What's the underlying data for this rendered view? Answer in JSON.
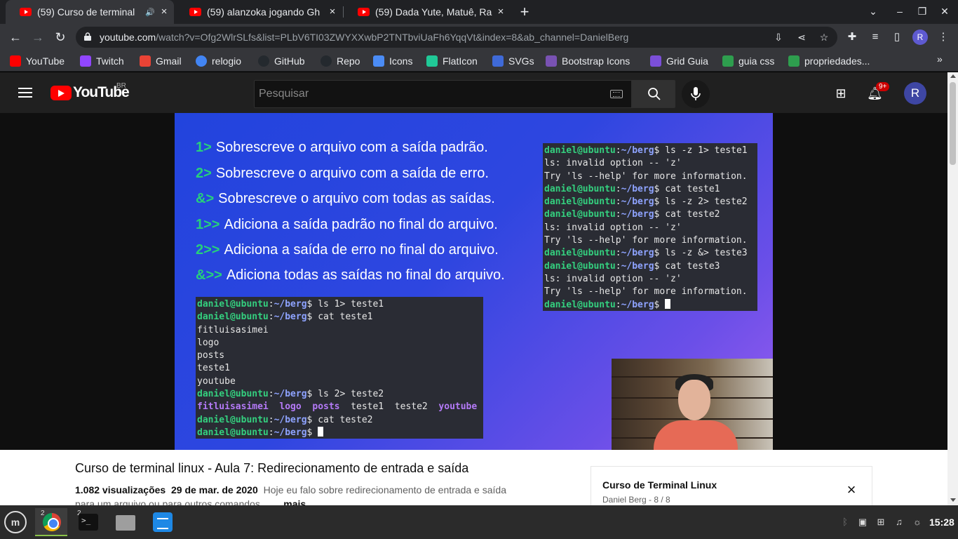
{
  "browser": {
    "tabs": [
      {
        "title": "(59) Curso de terminal",
        "active": true,
        "audio": true
      },
      {
        "title": "(59) alanzoka jogando Gh",
        "active": false
      },
      {
        "title": "(59) Dada Yute, Matuê, Ra",
        "active": false
      }
    ],
    "url_host": "youtube.com",
    "url_path": "/watch?v=Ofg2WlrSLfs&list=PLbV6TI03ZWYXXwbP2TNTbviUaFh6YqqVt&index=8&ab_channel=DanielBerg",
    "profile_initial": "R",
    "bookmarks": [
      {
        "label": "YouTube",
        "color": "#ff0000"
      },
      {
        "label": "Twitch",
        "color": "#9146ff"
      },
      {
        "label": "Gmail",
        "color": "#ea4335"
      },
      {
        "label": "relogio",
        "color": "#4285f4"
      },
      {
        "label": "GitHub",
        "color": "#24292e"
      },
      {
        "label": "Repo",
        "color": "#24292e"
      },
      {
        "label": "Icons",
        "color": "#4b8cf5"
      },
      {
        "label": "FlatIcon",
        "color": "#20c997"
      },
      {
        "label": "SVGs",
        "color": "#3f6ad8"
      },
      {
        "label": "Bootstrap Icons",
        "color": "#7952b3"
      },
      {
        "label": "Grid Guia",
        "color": "#7b4fd8"
      },
      {
        "label": "guia css",
        "color": "#2e9e4e"
      },
      {
        "label": "propriedades...",
        "color": "#2e9e4e"
      }
    ]
  },
  "youtube": {
    "logo_text": "YouTube",
    "country": "BR",
    "search_placeholder": "Pesquisar",
    "notification_count": "9+",
    "avatar_initial": "R"
  },
  "video": {
    "slide_lines": [
      {
        "op": "1>",
        "text": "Sobrescreve o arquivo com a saída padrão."
      },
      {
        "op": "2>",
        "text": "Sobrescreve o arquivo com a saída de erro."
      },
      {
        "op": "&>",
        "text": "Sobrescreve o arquivo com todas as saídas."
      },
      {
        "op": "1>>",
        "text": "Adiciona a saída padrão no final do arquivo."
      },
      {
        "op": "2>>",
        "text": "Adiciona a saída de erro no final do arquivo."
      },
      {
        "op": "&>>",
        "text": "Adiciona todas as saídas no final do arquivo."
      }
    ],
    "prompt_user": "daniel@ubuntu",
    "prompt_dir": "~/berg",
    "terminal_left": [
      {
        "cmd": "ls 1> teste1"
      },
      {
        "cmd": "cat teste1"
      },
      {
        "out": "fitluisasimei"
      },
      {
        "out": "logo"
      },
      {
        "out": "posts"
      },
      {
        "out": "teste1"
      },
      {
        "out": "youtube"
      },
      {
        "cmd": "ls 2> teste2"
      },
      {
        "dirs": [
          "fitluisasimei",
          "logo",
          "posts"
        ],
        "files": [
          "teste1",
          "teste2"
        ],
        "dirs2": [
          "youtube"
        ]
      },
      {
        "cmd": "cat teste2"
      },
      {
        "cmd": "",
        "cursor": true
      }
    ],
    "terminal_right": [
      {
        "cmd": "ls -z 1> teste1"
      },
      {
        "out": "ls: invalid option -- 'z'"
      },
      {
        "out": "Try 'ls --help' for more information."
      },
      {
        "cmd": "cat teste1"
      },
      {
        "cmd": "ls -z 2> teste2"
      },
      {
        "cmd": "cat teste2"
      },
      {
        "out": "ls: invalid option -- 'z'"
      },
      {
        "out": "Try 'ls --help' for more information."
      },
      {
        "cmd": "ls -z &> teste3"
      },
      {
        "cmd": "cat teste3"
      },
      {
        "out": "ls: invalid option -- 'z'"
      },
      {
        "out": "Try 'ls --help' for more information."
      },
      {
        "cmd": "",
        "cursor": true
      }
    ]
  },
  "video_info": {
    "title": "Curso de terminal linux - Aula 7: Redirecionamento de entrada e saída",
    "views": "1.082 visualizações",
    "date": "29 de mar. de 2020",
    "description_line1": "Hoje eu falo sobre redirecionamento de entrada e saída",
    "description_line2": "para um arquivo ou para outros comandos.",
    "more": "...mais"
  },
  "playlist": {
    "title": "Curso de Terminal Linux",
    "subtitle": "Daniel Berg - 8 / 8"
  },
  "taskbar": {
    "chrome_badge": "2",
    "terminal_badge": "2",
    "clock": "15:28"
  }
}
